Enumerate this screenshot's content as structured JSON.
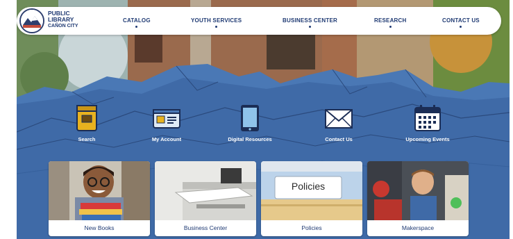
{
  "logo": {
    "line1": "PUBLIC",
    "line2": "LIBRARY",
    "line3": "CAÑON CITY"
  },
  "nav": [
    {
      "label": "CATALOG"
    },
    {
      "label": "YOUTH SERVICES"
    },
    {
      "label": "BUSINESS CENTER"
    },
    {
      "label": "RESEARCH"
    },
    {
      "label": "CONTACT US"
    }
  ],
  "quick_links": [
    {
      "label": "Search",
      "icon": "book-icon"
    },
    {
      "label": "My Account",
      "icon": "id-card-icon"
    },
    {
      "label": "Digital Resources",
      "icon": "tablet-icon"
    },
    {
      "label": "Contact Us",
      "icon": "envelope-icon"
    },
    {
      "label": "Upcoming Events",
      "icon": "calendar-icon"
    }
  ],
  "cards": [
    {
      "label": "New Books"
    },
    {
      "label": "Business Center"
    },
    {
      "label": "Policies",
      "image_text": "Policies"
    },
    {
      "label": "Makerspace"
    }
  ],
  "colors": {
    "brand": "#1f3a73",
    "mountain": "#3f6fae",
    "accent": "#e8b21f"
  }
}
